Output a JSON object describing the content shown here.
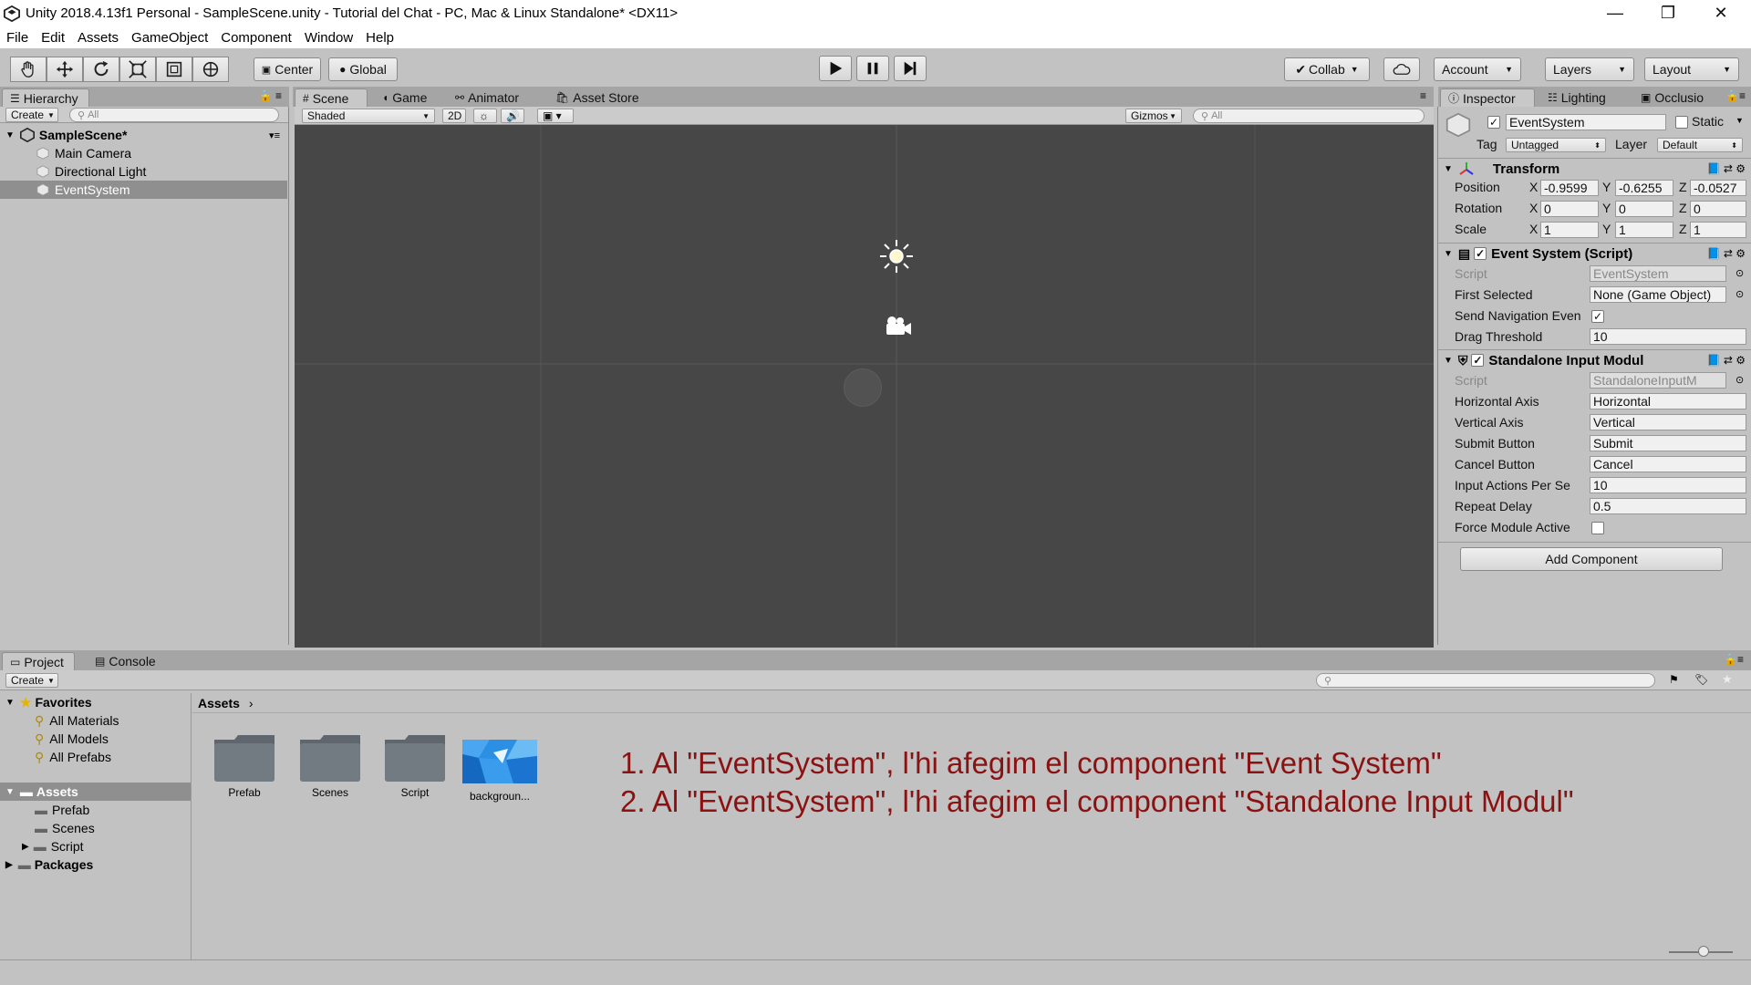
{
  "window": {
    "title": "Unity 2018.4.13f1 Personal - SampleScene.unity - Tutorial del Chat - PC, Mac & Linux Standalone* <DX11>",
    "minimize": "—",
    "maximize": "❐",
    "close": "✕"
  },
  "menu": [
    "File",
    "Edit",
    "Assets",
    "GameObject",
    "Component",
    "Window",
    "Help"
  ],
  "toolbar": {
    "pivot_label": "Center",
    "space_label": "Global",
    "collab_label": "Collab",
    "account_label": "Account",
    "layers_label": "Layers",
    "layout_label": "Layout"
  },
  "hierarchy": {
    "tab": "Hierarchy",
    "create": "Create",
    "search_placeholder": "All",
    "scene": "SampleScene*",
    "items": [
      "Main Camera",
      "Directional Light",
      "EventSystem"
    ],
    "selected": "EventSystem"
  },
  "scene": {
    "tabs": [
      "Scene",
      "Game",
      "Animator",
      "Asset Store"
    ],
    "shading": "Shaded",
    "mode_2d": "2D",
    "gizmos": "Gizmos",
    "search_placeholder": "All"
  },
  "inspector": {
    "tabs": [
      "Inspector",
      "Lighting",
      "Occlusio"
    ],
    "object_name": "EventSystem",
    "static_label": "Static",
    "tag_label": "Tag",
    "tag_value": "Untagged",
    "layer_label": "Layer",
    "layer_value": "Default",
    "transform": {
      "title": "Transform",
      "position_label": "Position",
      "rotation_label": "Rotation",
      "scale_label": "Scale",
      "axis_x": "X",
      "axis_y": "Y",
      "axis_z": "Z",
      "position": [
        "-0.9599",
        "-0.6255",
        "-0.0527"
      ],
      "rotation": [
        "0",
        "0",
        "0"
      ],
      "scale": [
        "1",
        "1",
        "1"
      ]
    },
    "event_system": {
      "title": "Event System (Script)",
      "script_label": "Script",
      "script_value": "EventSystem",
      "first_selected_label": "First Selected",
      "first_selected_value": "None (Game Object)",
      "send_nav_label": "Send Navigation Even",
      "send_nav_checked": "✓",
      "drag_label": "Drag Threshold",
      "drag_value": "10"
    },
    "standalone": {
      "title": "Standalone Input Modul",
      "script_label": "Script",
      "script_value": "StandaloneInputM",
      "horizontal_label": "Horizontal Axis",
      "horizontal_value": "Horizontal",
      "vertical_label": "Vertical Axis",
      "vertical_value": "Vertical",
      "submit_label": "Submit Button",
      "submit_value": "Submit",
      "cancel_label": "Cancel Button",
      "cancel_value": "Cancel",
      "input_actions_label": "Input Actions Per Se",
      "input_actions_value": "10",
      "repeat_label": "Repeat Delay",
      "repeat_value": "0.5",
      "force_label": "Force Module Active"
    },
    "add_component": "Add Component"
  },
  "project": {
    "tabs": [
      "Project",
      "Console"
    ],
    "create": "Create",
    "favorites_label": "Favorites",
    "favorites": [
      "All Materials",
      "All Models",
      "All Prefabs"
    ],
    "assets_label": "Assets",
    "asset_folders": [
      "Prefab",
      "Scenes",
      "Script"
    ],
    "packages_label": "Packages",
    "breadcrumb": "Assets",
    "grid_items": [
      "Prefab",
      "Scenes",
      "Script",
      "backgroun..."
    ]
  },
  "instructions": [
    "1. Al \"EventSystem\", l'hi afegim el component \"Event System\"",
    "2. Al \"EventSystem\", l'hi afegim el component \"Standalone Input Modul\""
  ],
  "colors": {
    "instruction_text": "#8b1212",
    "scene_background": "#474747",
    "panel_background": "#c2c2c2"
  }
}
